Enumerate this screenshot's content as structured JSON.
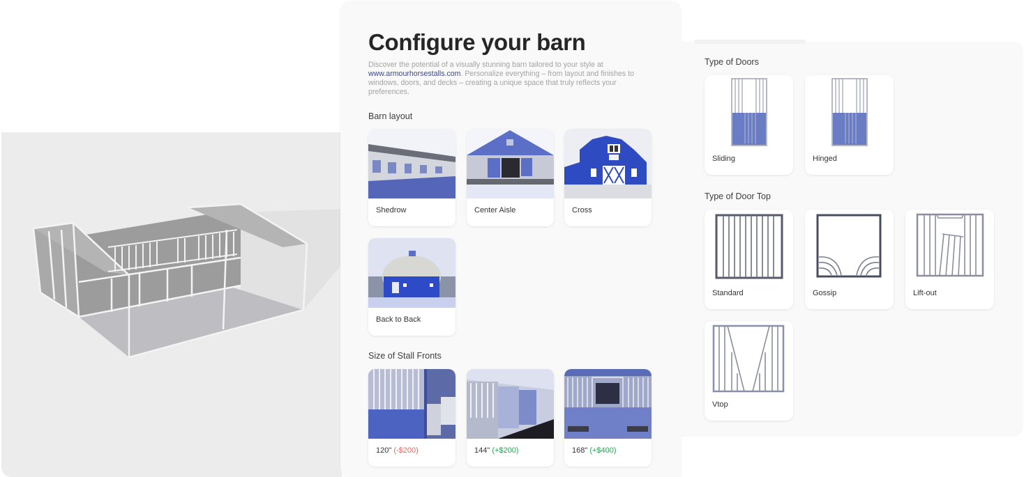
{
  "viewport": {
    "scene": "3d-barn-preview"
  },
  "configurator": {
    "title": "Configure your barn",
    "description_before_link": "Discover the potential of a visually stunning barn tailored to your style at ",
    "description_link": "www.armourhorsestalls.com",
    "description_after_link": ". Personalize everything – from layout and finishes to windows, doors, and decks – creating a unique space that truly reflects your preferences.",
    "barn_layout": {
      "label": "Barn layout",
      "options": [
        {
          "label": "Shedrow",
          "image": "shedrow-barn-photo"
        },
        {
          "label": "Center Aisle",
          "image": "center-aisle-barn-photo"
        },
        {
          "label": "Cross",
          "image": "cross-barn-photo"
        },
        {
          "label": "Back to Back",
          "image": "round-barn-photo"
        }
      ]
    },
    "stall_fronts": {
      "label": "Size of Stall Fronts",
      "options": [
        {
          "size": "120\"",
          "price": "(-$200)",
          "price_color": "#e26565"
        },
        {
          "size": "144\"",
          "price": "(+$200)",
          "price_color": "#2e9e55"
        },
        {
          "size": "168\"",
          "price": "(+$400)",
          "price_color": "#2e9e55"
        }
      ]
    }
  },
  "doors": {
    "label": "Type of Doors",
    "options": [
      {
        "label": "Sliding",
        "image": "sliding-door-image"
      },
      {
        "label": "Hinged",
        "image": "hinged-door-image"
      }
    ]
  },
  "door_top": {
    "label": "Type of Door Top",
    "options": [
      {
        "label": "Standard",
        "image": "standard-door-top-image"
      },
      {
        "label": "Gossip",
        "image": "gossip-door-top-image"
      },
      {
        "label": "Lift-out",
        "image": "lift-out-door-top-image"
      },
      {
        "label": "Vtop",
        "image": "vtop-door-top-image"
      }
    ]
  }
}
